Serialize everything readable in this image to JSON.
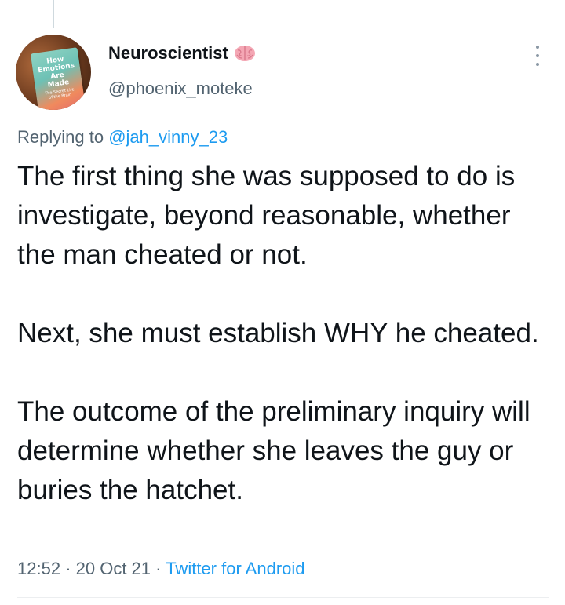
{
  "author": {
    "display_name": "Neuroscientist",
    "handle": "@phoenix_moteke",
    "badge_icon": "brain-icon",
    "avatar": {
      "book_title": "How\nEmotions\nAre\nMade",
      "book_subtitle": "The Secret Life\nof the Brain"
    }
  },
  "reply": {
    "prefix": "Replying to",
    "mention": "@jah_vinny_23"
  },
  "tweet": {
    "paragraphs": [
      "The first thing she was supposed to do is investigate, beyond reasonable, whether the man cheated or not.",
      "Next, she must establish WHY he cheated.",
      "The outcome of the preliminary inquiry will determine whether she leaves the guy or buries the hatchet."
    ]
  },
  "meta": {
    "time": "12:52",
    "date": "20 Oct 21",
    "separator": "·",
    "source": "Twitter for Android"
  },
  "colors": {
    "link": "#1d9bf0",
    "secondary_text": "#536471",
    "primary_text": "#0f1419",
    "brain_pink": "#f4a7b4"
  }
}
